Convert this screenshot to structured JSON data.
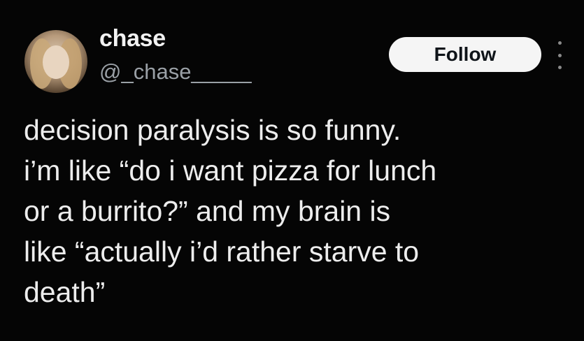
{
  "user": {
    "name": "chase",
    "handle": "@_chase_____"
  },
  "actions": {
    "follow_label": "Follow",
    "more_icon": "more-vertical-icon"
  },
  "tweet": {
    "lines": [
      "decision paralysis is so funny.",
      "i’m like “do i want pizza for lunch",
      "or a burrito?” and my brain is",
      "like “actually i’d rather starve to",
      "death”"
    ]
  },
  "colors": {
    "background": "#000000",
    "text": "#ededed",
    "handle": "#9aa0a6",
    "button_bg": "#f5f5f5",
    "button_text": "#0f1419"
  }
}
